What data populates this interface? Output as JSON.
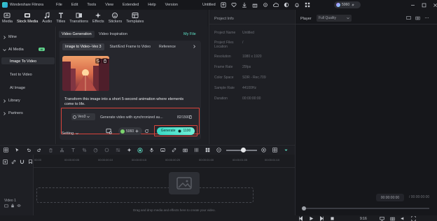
{
  "app": {
    "name": "Wondershare Filmora",
    "menu": [
      "File",
      "Edit",
      "Tools",
      "View",
      "Extended",
      "Help",
      "Version"
    ],
    "doc_title": "Untitled",
    "credits": "5060"
  },
  "toolbar": {
    "tools": [
      {
        "label": "Media",
        "icon": "media-icon"
      },
      {
        "label": "Stock Media",
        "icon": "stock-media-icon"
      },
      {
        "label": "Audio",
        "icon": "music-note-icon"
      },
      {
        "label": "Titles",
        "icon": "text-t-icon"
      },
      {
        "label": "Transitions",
        "icon": "transitions-icon"
      },
      {
        "label": "Effects",
        "icon": "effects-icon"
      },
      {
        "label": "Stickers",
        "icon": "stickers-icon"
      },
      {
        "label": "Templates",
        "icon": "templates-icon"
      }
    ]
  },
  "sidebar": {
    "mine": "Mine",
    "ai_media": "AI Media",
    "ai_badge": "AI",
    "items": [
      "Image To Video",
      "Text to Video",
      "AI Image"
    ],
    "library": "Library",
    "partners": "Partners"
  },
  "main": {
    "tab_generation": "Video Generation",
    "tab_inspiration": "Video Inspiration",
    "my_file": "My File",
    "sub_tabs": [
      "Image to Video--Veo 3",
      "Start/End Frame to Video",
      "Reference"
    ],
    "prompt": "Transform this image into a short 5-second animation where elements come to life.",
    "model": "Veo3",
    "audio_label": "Generate video with synchronized au...",
    "char_count": "82/1500",
    "setting": "Setting",
    "credit_amount": "5060",
    "generate_label": "Generate",
    "generate_cost": "1100"
  },
  "project_info": {
    "title": "Project Info",
    "rows": [
      {
        "k": "Project Name",
        "v": "Untitled"
      },
      {
        "k": "Project Files Location",
        "v": "/"
      },
      {
        "k": "Resolution",
        "v": "1080 x 1920"
      },
      {
        "k": "Frame Rate",
        "v": "25fps"
      },
      {
        "k": "Color Space",
        "v": "SDR - Rec.709"
      },
      {
        "k": "Sample Rate",
        "v": "44100Hz"
      },
      {
        "k": "Duration",
        "v": "00:00:00:00"
      }
    ]
  },
  "player": {
    "label": "Player",
    "quality": "Full Quality",
    "time_current": "00:00:00:00",
    "time_total": "/ 00:00:00:00",
    "ratio": "9:16"
  },
  "timeline": {
    "ticks": [
      "00:00",
      "00:00:00:05",
      "00:00:00:10",
      "00:00:00:15",
      "00:00:00:20",
      "00:00:01:00",
      "00:00:01:05",
      "00:00:01:10"
    ],
    "drop_text": "Drag and drop media and effects here to create your video.",
    "track_label": "Video 1"
  },
  "colors": {
    "accent": "#5fe3c8",
    "highlight_outline": "#d9443b",
    "panel": "#1e1f24"
  }
}
